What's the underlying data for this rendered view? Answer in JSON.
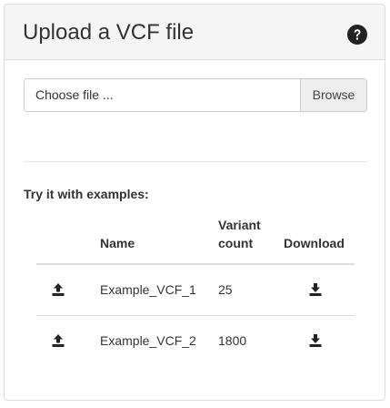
{
  "panel": {
    "title": "Upload a VCF file",
    "help_icon": "question-circle-icon"
  },
  "file_input": {
    "placeholder": "Choose file ...",
    "browse_label": "Browse"
  },
  "examples": {
    "title": "Try it with examples:",
    "columns": {
      "upload": "",
      "name": "Name",
      "variant_count_line1": "Variant",
      "variant_count_line2": "count",
      "download": "Download"
    },
    "rows": [
      {
        "upload_icon": "upload-icon",
        "name": "Example_VCF_1",
        "variant_count": "25",
        "download_icon": "download-icon"
      },
      {
        "upload_icon": "upload-icon",
        "name": "Example_VCF_2",
        "variant_count": "1800",
        "download_icon": "download-icon"
      }
    ]
  },
  "colors": {
    "header_bg": "#f5f5f5",
    "border": "#dddddd",
    "text": "#333333",
    "browse_bg": "#eeeeee"
  }
}
